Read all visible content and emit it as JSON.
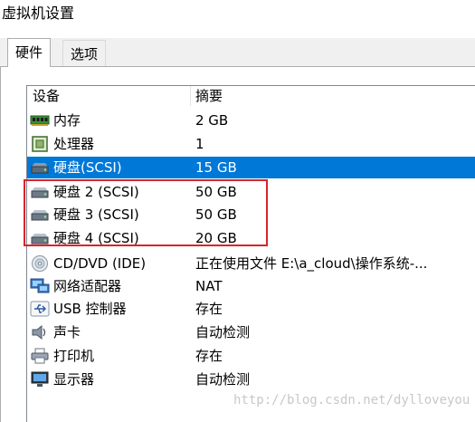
{
  "window": {
    "title": "虚拟机设置"
  },
  "tabs": [
    {
      "label": "硬件",
      "active": true
    },
    {
      "label": "选项",
      "active": false
    }
  ],
  "table": {
    "headers": [
      "设备",
      "摘要"
    ],
    "rows": [
      {
        "device": "内存",
        "summary": "2 GB",
        "icon": "memory-icon"
      },
      {
        "device": "处理器",
        "summary": "1",
        "icon": "processor-icon"
      },
      {
        "device": "硬盘(SCSI)",
        "summary": "15 GB",
        "icon": "hard-disk-icon",
        "selected": true
      },
      {
        "device": "硬盘 2 (SCSI)",
        "summary": "50 GB",
        "icon": "hard-disk-icon"
      },
      {
        "device": "硬盘 3 (SCSI)",
        "summary": "50 GB",
        "icon": "hard-disk-icon"
      },
      {
        "device": "硬盘 4 (SCSI)",
        "summary": "20 GB",
        "icon": "hard-disk-icon"
      },
      {
        "device": "CD/DVD (IDE)",
        "summary": "正在使用文件 E:\\a_cloud\\操作系统-...",
        "icon": "cd-dvd-icon"
      },
      {
        "device": "网络适配器",
        "summary": "NAT",
        "icon": "network-adapter-icon"
      },
      {
        "device": "USB 控制器",
        "summary": "存在",
        "icon": "usb-icon"
      },
      {
        "device": "声卡",
        "summary": "自动检测",
        "icon": "speaker-icon"
      },
      {
        "device": "打印机",
        "summary": "存在",
        "icon": "printer-icon"
      },
      {
        "device": "显示器",
        "summary": "自动检测",
        "icon": "monitor-icon"
      }
    ]
  },
  "watermark": "http://blog.csdn.net/dylloveyou",
  "colors": {
    "selection": "#0078d7",
    "annotation_border": "#d9242b"
  }
}
